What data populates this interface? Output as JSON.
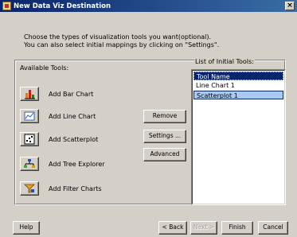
{
  "window": {
    "title": "New Data Viz Destination",
    "close_label": "×"
  },
  "description": {
    "line1": "Choose the types of visualization tools you want(optional).",
    "line2": "You can also select initial mappings by clicking on \"Settings\"."
  },
  "available_tools": {
    "label": "Available Tools:",
    "items": [
      {
        "label": "Add Bar Chart",
        "icon": "bar-chart-icon"
      },
      {
        "label": "Add Line Chart",
        "icon": "line-chart-icon"
      },
      {
        "label": "Add Scatterplot",
        "icon": "scatterplot-icon"
      },
      {
        "label": "Add Tree Explorer",
        "icon": "tree-explorer-icon"
      },
      {
        "label": "Add Filter Charts",
        "icon": "filter-charts-icon"
      }
    ]
  },
  "actions": {
    "remove": "Remove",
    "settings": "Settings ...",
    "advanced": "Advanced"
  },
  "initial_tools": {
    "label": "List of Initial Tools:",
    "header": "Tool Name",
    "items": [
      "Line Chart 1",
      "Scatterplot 1"
    ],
    "selected_index": 1
  },
  "footer": {
    "help": "Help",
    "back": "< Back",
    "next": "Next >",
    "finish": "Finish",
    "cancel": "Cancel"
  }
}
